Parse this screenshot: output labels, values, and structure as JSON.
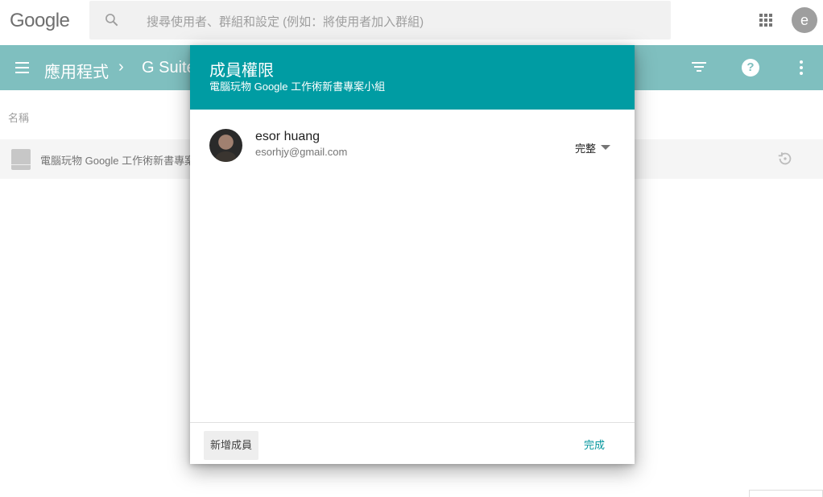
{
  "topbar": {
    "logo": "Google",
    "search_placeholder": "搜尋使用者、群組和設定 (例如：將使用者加入群組)",
    "account_initial": "e"
  },
  "appbar": {
    "breadcrumb_1": "應用程式",
    "breadcrumb_sep": "›",
    "breadcrumb_2": "G Suite",
    "help_label": "?"
  },
  "list": {
    "column_header": "名稱",
    "row_text": "電腦玩物 Google 工作術新書專案小組"
  },
  "dialog": {
    "title": "成員權限",
    "subtitle": "電腦玩物 Google 工作術新書專案小組",
    "members": [
      {
        "name": "esor huang",
        "email": "esorhjy@gmail.com",
        "role": "完整"
      }
    ],
    "add_member_label": "新增成員",
    "done_label": "完成"
  },
  "colors": {
    "header_teal": "#009ca3",
    "appbar_dimmed": "#7fbfbf",
    "accent": "#00959c"
  }
}
